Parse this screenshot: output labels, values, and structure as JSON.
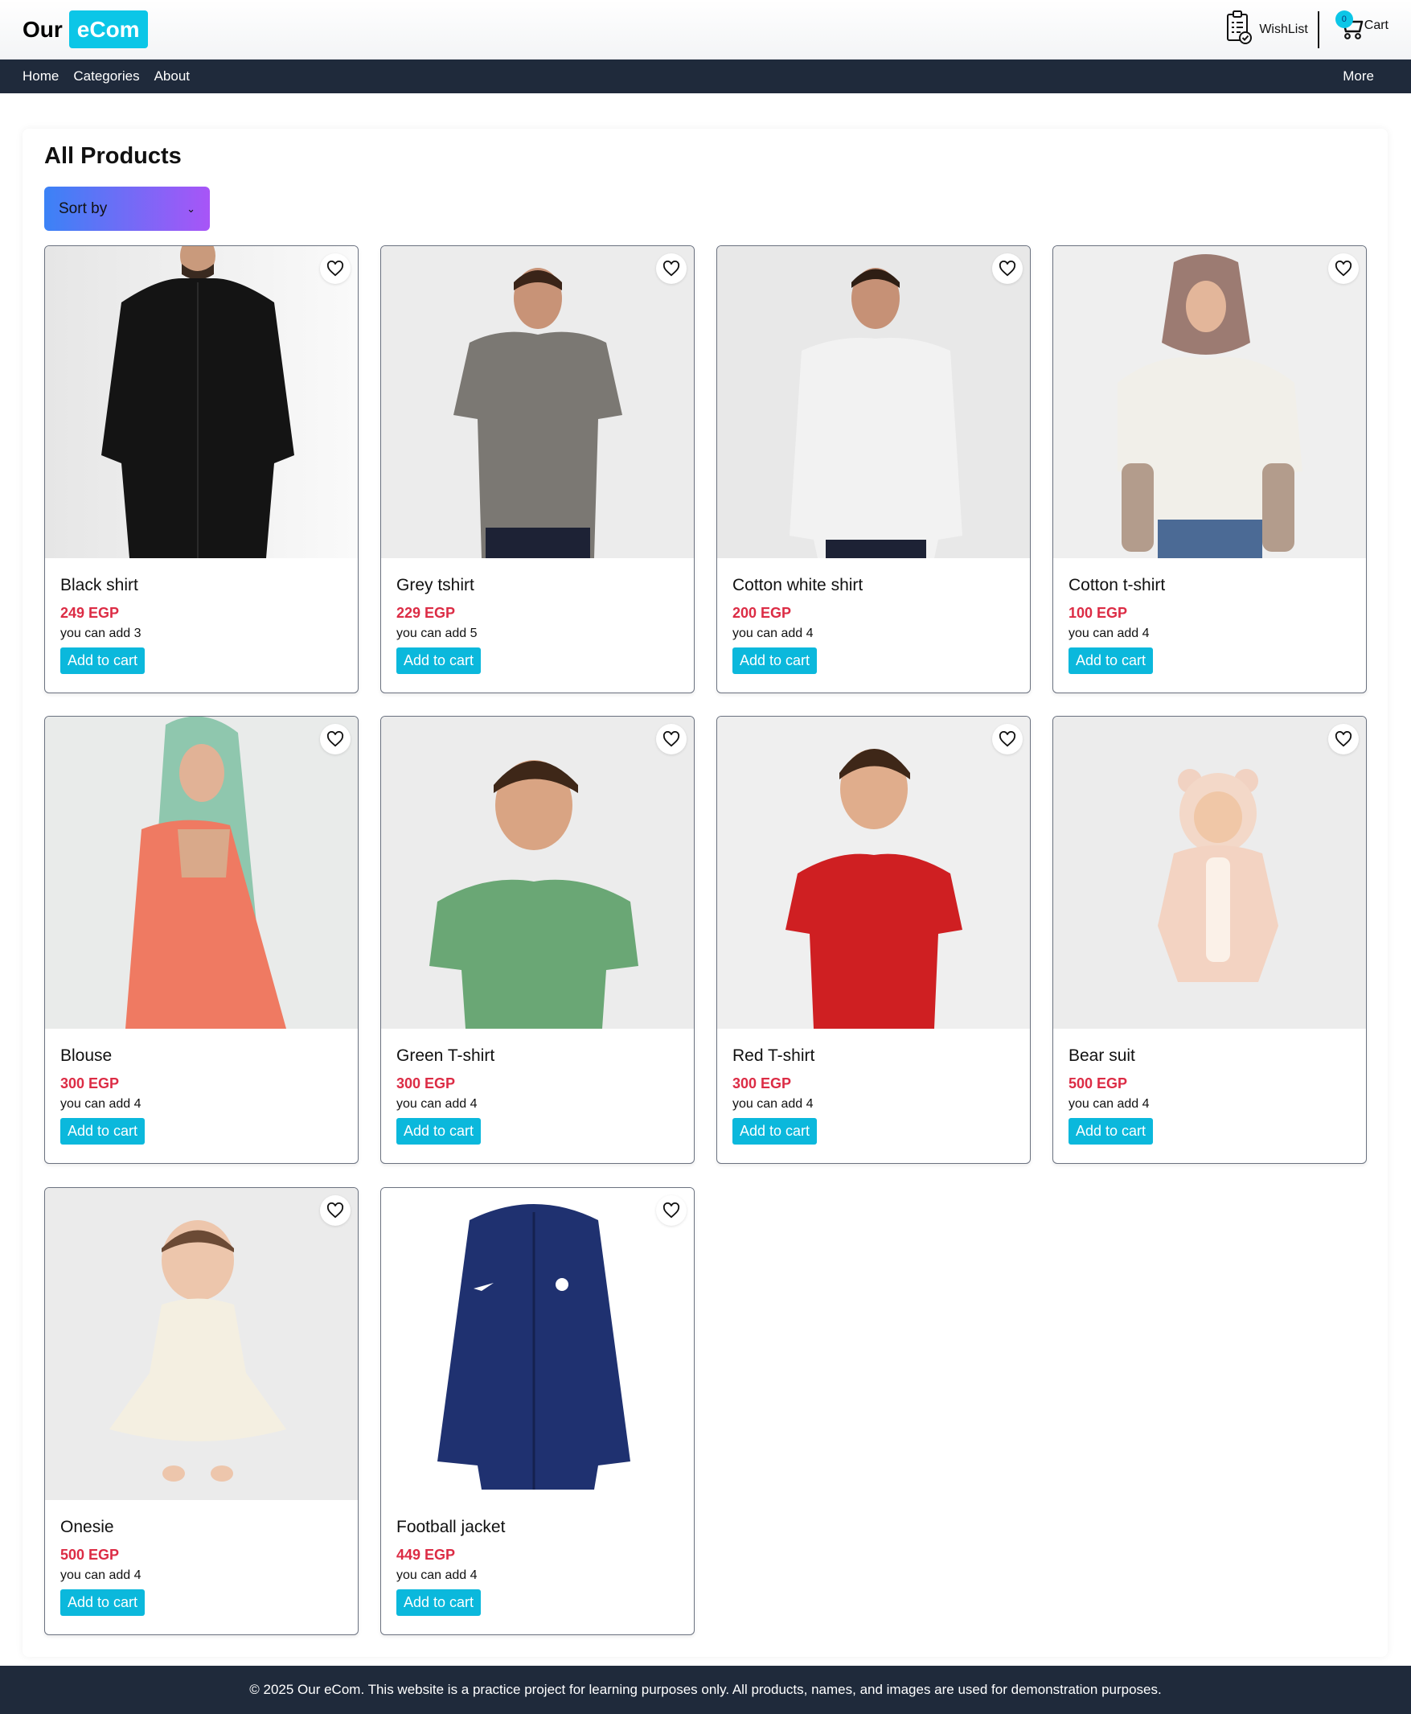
{
  "header": {
    "logo_our": "Our",
    "logo_ecom": "eCom",
    "wishlist_label": "WishList",
    "cart_label": "Cart",
    "cart_count": "0",
    "accent_color": "#0cc6e7"
  },
  "nav": {
    "items": [
      "Home",
      "Categories",
      "About"
    ],
    "more_label": "More"
  },
  "main": {
    "title": "All Products",
    "sort_label": "Sort by"
  },
  "products": [
    {
      "name": "Black shirt",
      "price": "249 EGP",
      "stock": "you can add 3",
      "button": "Add to cart",
      "image_icon": "man-black-shirt"
    },
    {
      "name": "Grey tshirt",
      "price": "229 EGP",
      "stock": "you can add 5",
      "button": "Add to cart",
      "image_icon": "man-grey-tshirt"
    },
    {
      "name": "Cotton white shirt",
      "price": "200 EGP",
      "stock": "you can add 4",
      "button": "Add to cart",
      "image_icon": "man-white-shirt"
    },
    {
      "name": "Cotton t-shirt",
      "price": "100 EGP",
      "stock": "you can add 4",
      "button": "Add to cart",
      "image_icon": "woman-hijab-tshirt"
    },
    {
      "name": "Blouse",
      "price": "300 EGP",
      "stock": "you can add 4",
      "button": "Add to cart",
      "image_icon": "woman-blouse"
    },
    {
      "name": "Green T-shirt",
      "price": "300 EGP",
      "stock": "you can add 4",
      "button": "Add to cart",
      "image_icon": "boy-green-tshirt"
    },
    {
      "name": "Red T-shirt",
      "price": "300 EGP",
      "stock": "you can add 4",
      "button": "Add to cart",
      "image_icon": "boy-red-tshirt"
    },
    {
      "name": "Bear suit",
      "price": "500 EGP",
      "stock": "you can add 4",
      "button": "Add to cart",
      "image_icon": "baby-bear-suit"
    },
    {
      "name": "Onesie",
      "price": "500 EGP",
      "stock": "you can add 4",
      "button": "Add to cart",
      "image_icon": "baby-onesie"
    },
    {
      "name": "Football jacket",
      "price": "449 EGP",
      "stock": "you can add 4",
      "button": "Add to cart",
      "image_icon": "navy-football-jacket"
    }
  ],
  "footer": {
    "text": "© 2025 Our eCom. This website is a practice project for learning purposes only. All products, names, and images are used for demonstration purposes."
  }
}
